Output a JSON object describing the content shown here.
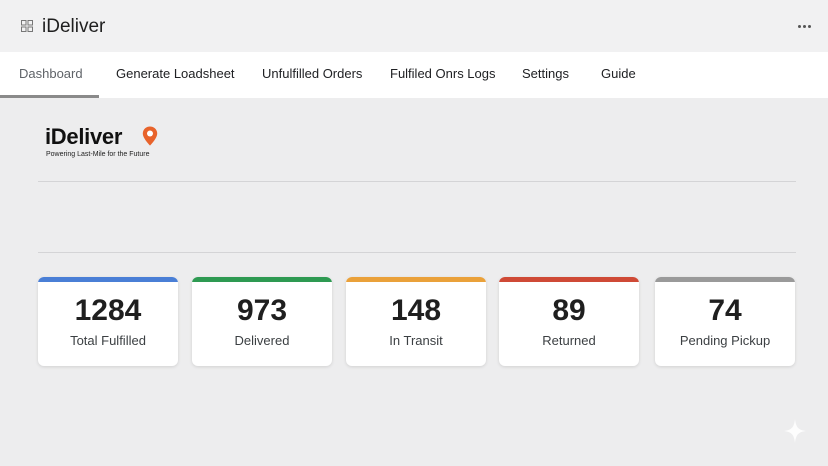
{
  "window": {
    "title": "iDeliver"
  },
  "tabs": [
    {
      "label": "Dashboard",
      "active": true
    },
    {
      "label": "Generate Loadsheet"
    },
    {
      "label": "Unfulfilled Orders"
    },
    {
      "label": "Fulfiled Onrs Logs"
    },
    {
      "label": "Settings"
    },
    {
      "label": "Guide"
    }
  ],
  "brand": {
    "name": "iDeliver",
    "tagline": "Powering Last-Mile for the Future",
    "pin_color": "#e8632b"
  },
  "stats": [
    {
      "value": "1284",
      "label": "Total Fulfilled",
      "color": "#4a7fd6"
    },
    {
      "value": "973",
      "label": "Delivered",
      "color": "#2e9a52"
    },
    {
      "value": "148",
      "label": "In Transit",
      "color": "#eaa13a"
    },
    {
      "value": "89",
      "label": "Returned",
      "color": "#cf4a36"
    },
    {
      "value": "74",
      "label": "Pending Pickup",
      "color": "#9a9a9a"
    }
  ],
  "icons": {
    "app": "grid-icon",
    "menu": "more-horizontal-icon",
    "logo": "map-pin-icon",
    "corner": "sparkle-icon"
  }
}
